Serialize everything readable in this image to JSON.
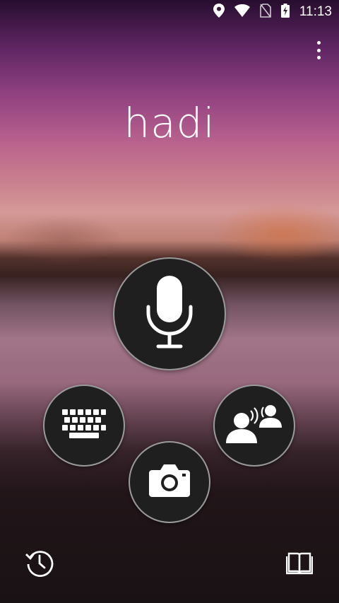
{
  "status_bar": {
    "time": "11:13",
    "icons": [
      "location-icon",
      "wifi-icon",
      "no-sim-icon",
      "battery-charging-icon"
    ]
  },
  "header": {
    "overflow_menu_icon": "more-vert-icon"
  },
  "main": {
    "recognized_text": "hadi"
  },
  "actions": {
    "voice": "microphone-icon",
    "keyboard": "keyboard-icon",
    "camera": "camera-icon",
    "conversation": "conversation-icon"
  },
  "bottom_bar": {
    "history": "history-icon",
    "phrasebook": "book-icon"
  },
  "colors": {
    "button_fill": "#1f1f1f",
    "button_border": "#ffffff",
    "icon": "#ffffff"
  }
}
